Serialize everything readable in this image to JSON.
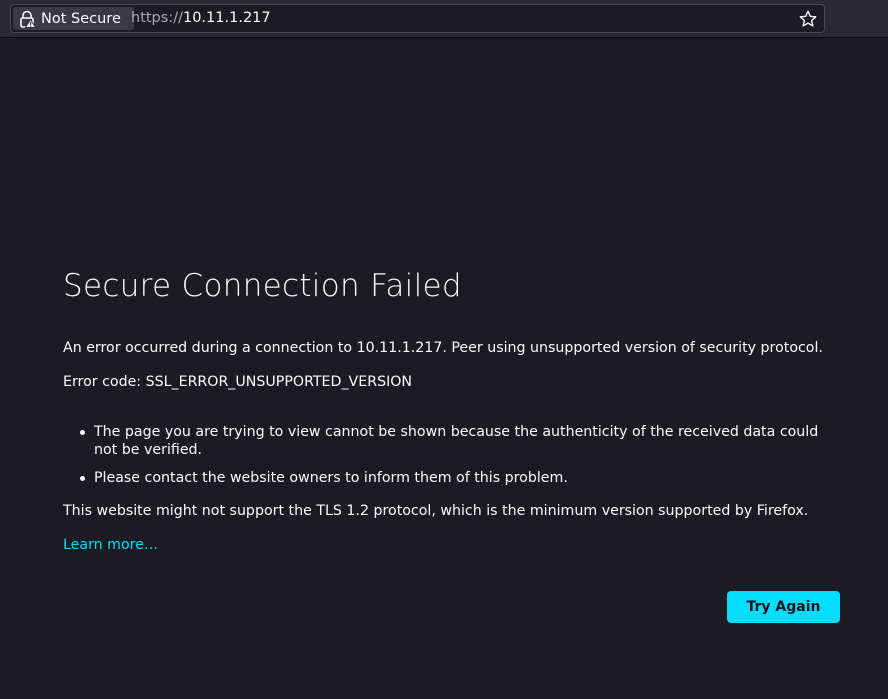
{
  "browser": {
    "security_label": "Not Secure",
    "url_scheme": "https://",
    "url_host": "10.11.1.217",
    "icons": {
      "security": "lock-warning-icon",
      "bookmark": "star-icon"
    }
  },
  "error_page": {
    "title": "Secure Connection Failed",
    "description": "An error occurred during a connection to 10.11.1.217. Peer using unsupported version of security protocol.",
    "error_code": "Error code: SSL_ERROR_UNSUPPORTED_VERSION",
    "bullets": [
      "The page you are trying to view cannot be shown because the authenticity of the received data could not be verified.",
      "Please contact the website owners to inform them of this problem."
    ],
    "tls_note": "This website might not support the TLS 1.2 protocol, which is the minimum version supported by Firefox.",
    "learn_more": "Learn more…",
    "try_again": "Try Again"
  },
  "colors": {
    "page_background": "#1c1b22",
    "toolbar_background": "#2b2a33",
    "accent": "#00ddff",
    "text": "#fbfbfe"
  }
}
